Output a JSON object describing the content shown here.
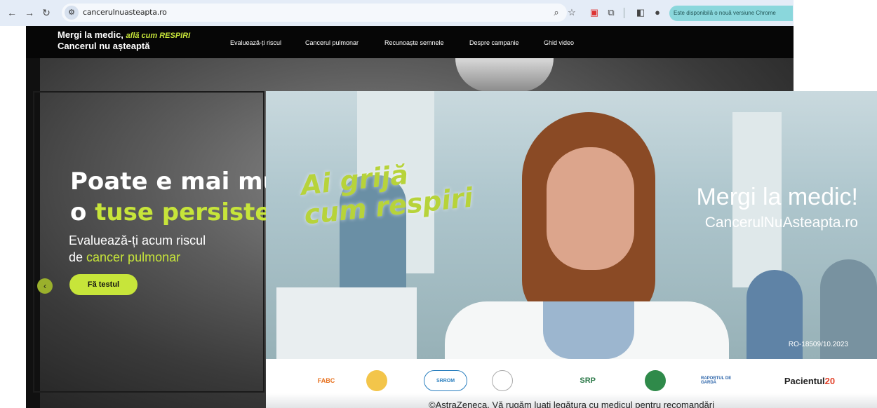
{
  "browser": {
    "url": "cancerulnuasteapta.ro",
    "update_notice": "Este disponibilă o nouă versiune Chrome"
  },
  "site": {
    "logo": {
      "line1_prefix": "Mergi la medic, ",
      "line1_accent": "află cum RESPIRI",
      "line2": "Cancerul nu așteaptă"
    },
    "nav": [
      "Evaluează-ți riscul",
      "Cancerul pulmonar",
      "Recunoaște semnele",
      "Despre campanie",
      "Ghid video"
    ],
    "hero": {
      "title_line1": "Poate e mai mul",
      "title_line2_prefix": "o ",
      "title_line2_accent": "tuse persisten",
      "sub_line1": "Evaluează-ți acum riscul",
      "sub_line2_prefix": "de ",
      "sub_line2_accent": "cancer pulmonar",
      "cta": "Fă testul"
    }
  },
  "ad": {
    "slogan_line1": "Ai grijă",
    "slogan_line2": "cum respiri",
    "headline": "Mergi la medic!",
    "url": "CancerulNuAsteapta.ro",
    "code": "RO-18509/10.2023",
    "logos": {
      "fabc": "FABC",
      "srrom": "SRROM",
      "srp": "SRP",
      "raport": "RAPORTUL DE GARDĂ",
      "pacientul": "Pacientul",
      "pacientul_num": "20"
    },
    "disclaimer": "©AstraZeneca. Vă rugăm luați legătura cu medicul pentru recomandări"
  },
  "colors": {
    "accent": "#c7e53a",
    "chrome_bg": "#e4ecf7",
    "update_pill": "#8ad7dc"
  }
}
